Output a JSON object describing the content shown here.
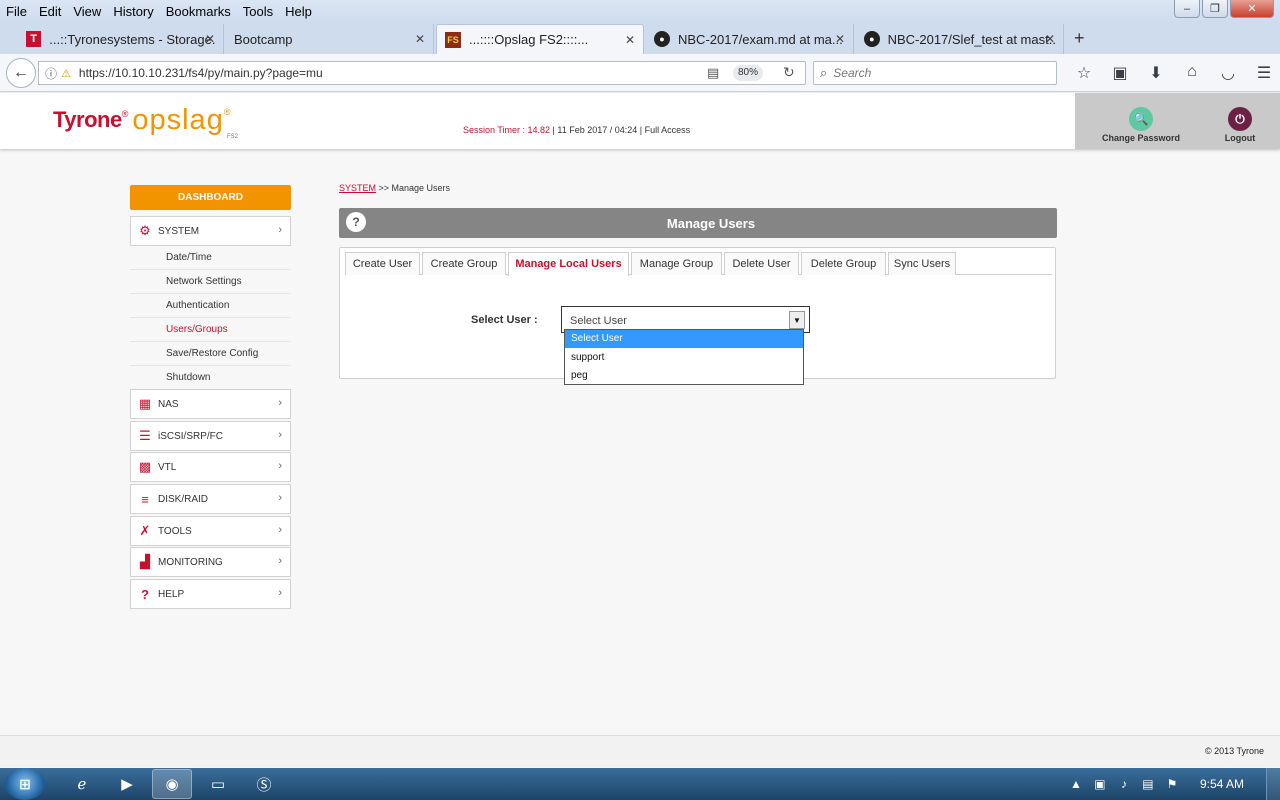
{
  "browser": {
    "menu": [
      "File",
      "Edit",
      "View",
      "History",
      "Bookmarks",
      "Tools",
      "Help"
    ],
    "tabs": [
      {
        "title": "...::Tyronesystems - Storage...",
        "icon": "tyrone-favicon"
      },
      {
        "title": "Bootcamp",
        "icon": ""
      },
      {
        "title": "...::::Opslag FS2::::...",
        "icon": "opslag-favicon"
      },
      {
        "title": "NBC-2017/exam.md at ma...",
        "icon": "github-icon"
      },
      {
        "title": "NBC-2017/Slef_test at mast...",
        "icon": "github-icon"
      }
    ],
    "url": "https://10.10.10.231/fs4/py/main.py?page=mu",
    "zoom": "80%",
    "search_placeholder": "Search"
  },
  "header": {
    "brand": "Tyrone",
    "product": "opslag",
    "product_sub": "FS2",
    "session_timer": "Session Timer : 14.82",
    "session_info": " | 11 Feb 2017 / 04:24 | Full Access",
    "change_password": "Change Password",
    "logout": "Logout"
  },
  "sidebar": {
    "dashboard": "DASHBOARD",
    "system": "SYSTEM",
    "system_items": [
      "Date/Time",
      "Network Settings",
      "Authentication",
      "Users/Groups",
      "Save/Restore Config",
      "Shutdown"
    ],
    "sections": [
      "NAS",
      "iSCSI/SRP/FC",
      "VTL",
      "DISK/RAID",
      "TOOLS",
      "MONITORING",
      "HELP"
    ]
  },
  "breadcrumb": {
    "link": "SYSTEM",
    "sep": " >> ",
    "current": "Manage Users"
  },
  "panel": {
    "title": "Manage Users",
    "tabs": [
      "Create User",
      "Create Group",
      "Manage Local Users",
      "Manage Group",
      "Delete User",
      "Delete Group",
      "Sync Users"
    ],
    "active_tab": "Manage Local Users",
    "field_label": "Select User :",
    "select_value": "Select User",
    "options": [
      "Select User",
      "support",
      "peg"
    ]
  },
  "footer": {
    "copyright": "© 2013 Tyrone"
  },
  "taskbar": {
    "clock": "9:54 AM"
  }
}
